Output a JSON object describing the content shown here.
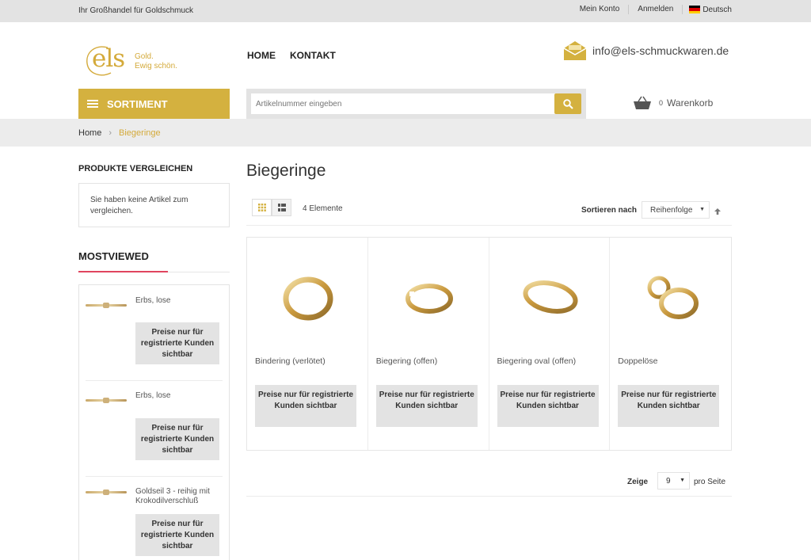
{
  "topbar": {
    "tagline": "Ihr Großhandel für Goldschmuck",
    "links": [
      "Mein Konto",
      "Anmelden"
    ],
    "language": "Deutsch"
  },
  "header": {
    "logo_text": "els",
    "logo_tag_line1": "Gold.",
    "logo_tag_line2": "Ewig schön.",
    "nav": [
      "HOME",
      "KONTAKT"
    ],
    "email": "info@els-schmuckwaren.de",
    "sortiment_label": "SORTIMENT",
    "search_placeholder": "Artikelnummer eingeben",
    "cart_count": "0",
    "cart_label": "Warenkorb"
  },
  "breadcrumb": {
    "home": "Home",
    "separator": "›",
    "current": "Biegeringe"
  },
  "sidebar": {
    "compare_title": "PRODUKTE VERGLEICHEN",
    "compare_text": "Sie haben keine Artikel zum vergleichen.",
    "mostviewed_title": "MOSTVIEWED",
    "items": [
      {
        "name": "Erbs, lose",
        "price_note": "Preise nur für registrierte Kunden sichtbar"
      },
      {
        "name": "Erbs, lose",
        "price_note": "Preise nur für registrierte Kunden sichtbar"
      },
      {
        "name": "Goldseil 3 - reihig mit Krokodilverschluß",
        "price_note": "Preise nur für registrierte Kunden sichtbar"
      }
    ]
  },
  "main": {
    "title": "Biegeringe",
    "count": "4 Elemente",
    "sort_label": "Sortieren nach",
    "sort_value": "Reihenfolge",
    "products": [
      {
        "name": "Bindering (verlötet)",
        "price_note": "Preise nur für registrierte Kunden sichtbar",
        "shape": "ring-closed"
      },
      {
        "name": "Biegering (offen)",
        "price_note": "Preise nur für registrierte Kunden sichtbar",
        "shape": "ring-open"
      },
      {
        "name": "Biegering oval (offen)",
        "price_note": "Preise nur für registrierte Kunden sichtbar",
        "shape": "ring-oval"
      },
      {
        "name": "Doppelöse",
        "price_note": "Preise nur für registrierte Kunden sichtbar",
        "shape": "double-loop"
      }
    ],
    "show_label": "Zeige",
    "show_value": "9",
    "per_page": "pro Seite"
  },
  "colors": {
    "accent_gold": "#d4b13f",
    "compare_underline": "#e0455f"
  }
}
